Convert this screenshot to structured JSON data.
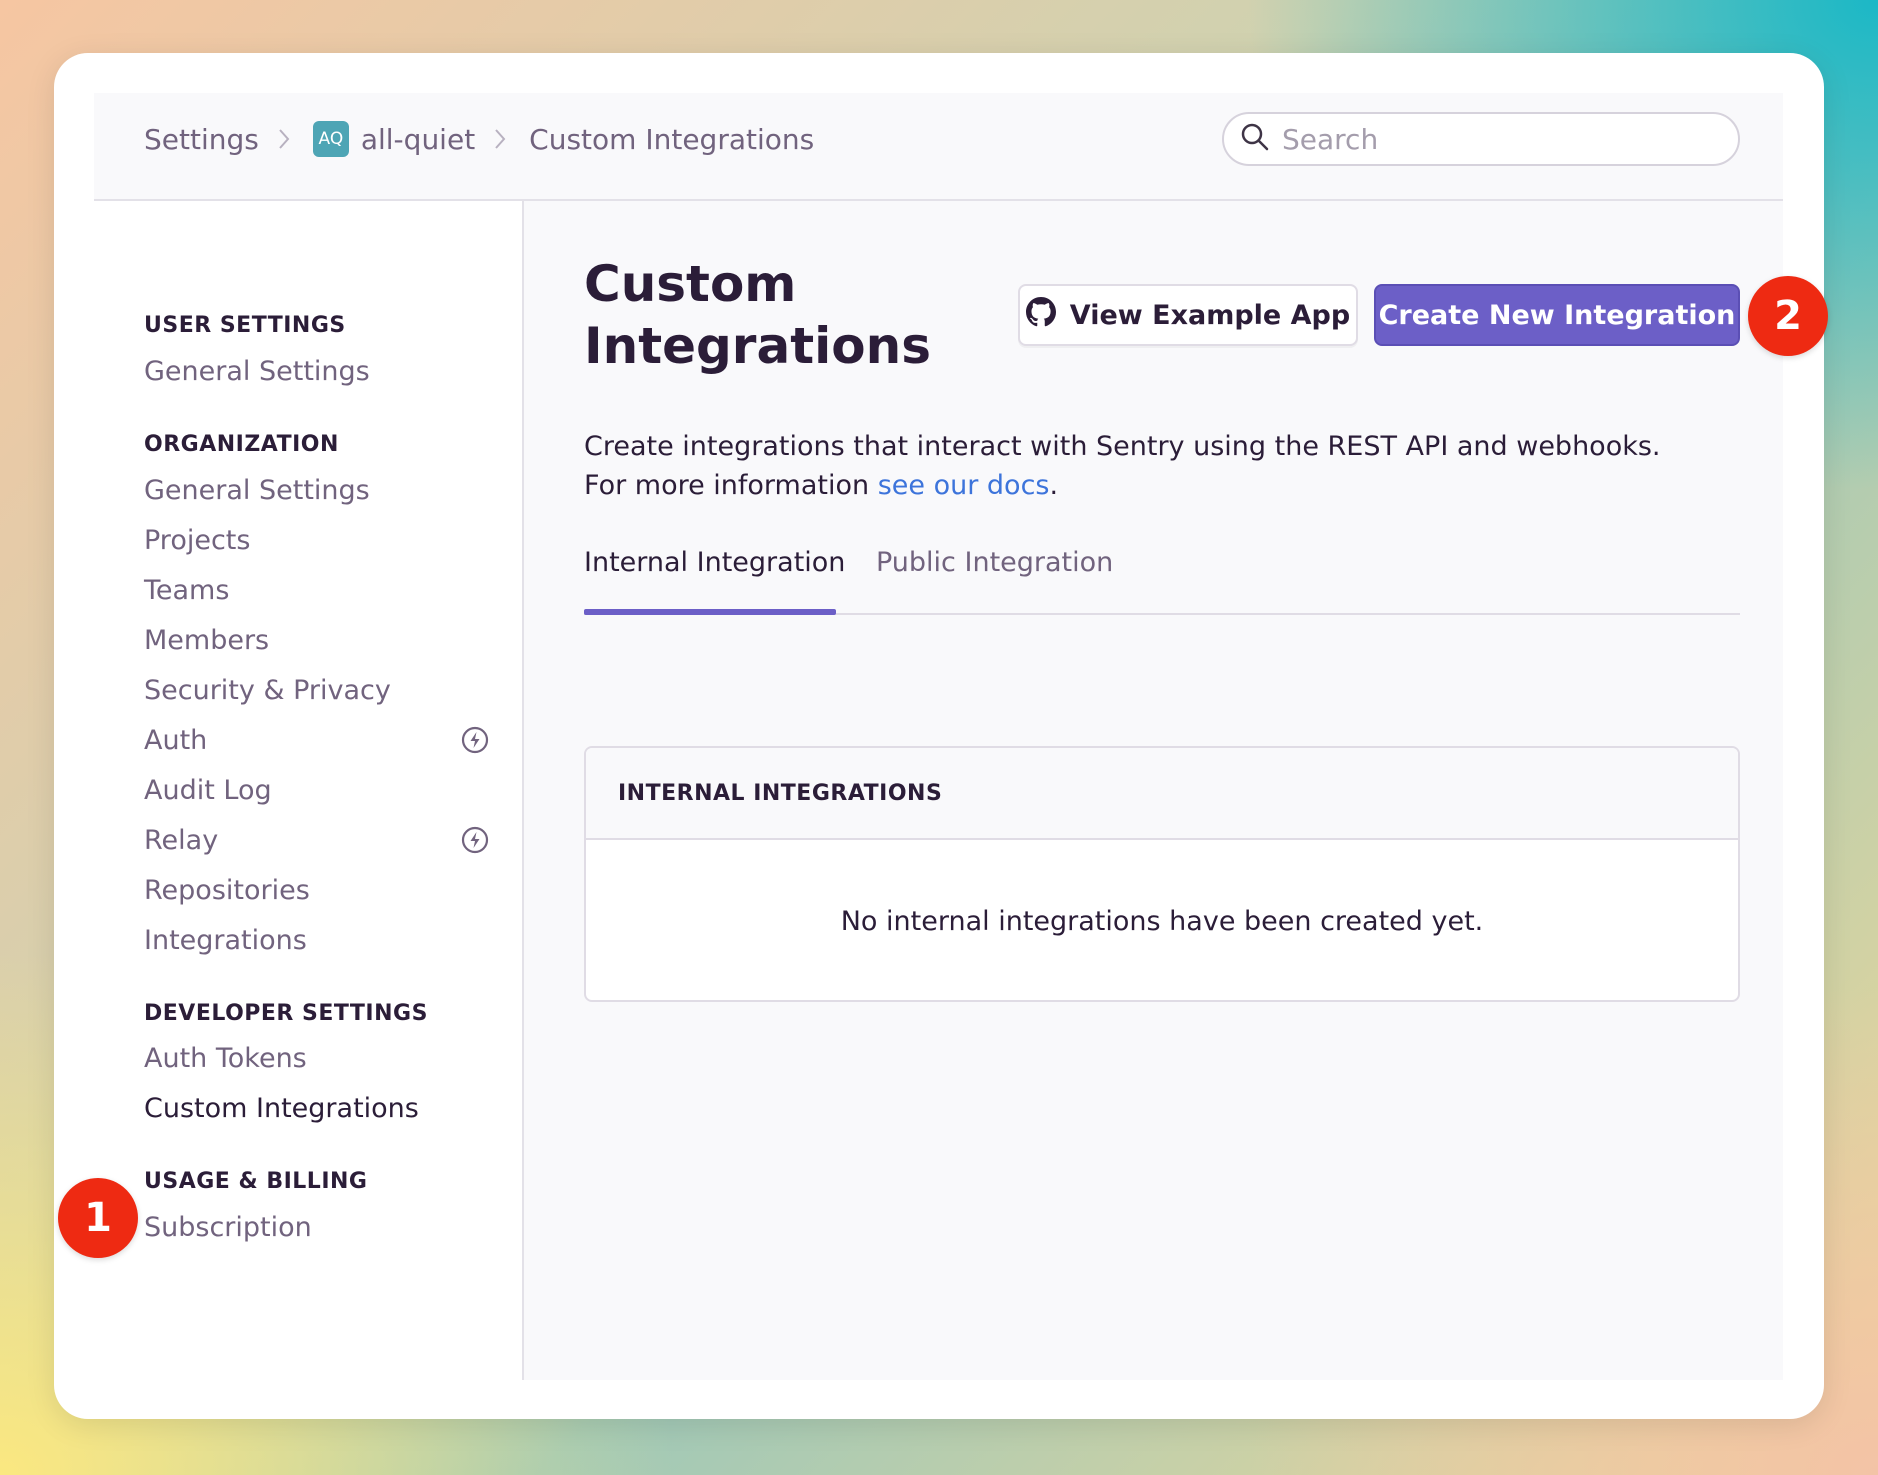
{
  "breadcrumb": {
    "settings": "Settings",
    "org_initials": "AQ",
    "org_name": "all-quiet",
    "current": "Custom Integrations"
  },
  "search": {
    "placeholder": "Search"
  },
  "sidebar": {
    "user_settings_title": "USER SETTINGS",
    "user_settings_items": [
      "General Settings"
    ],
    "organization_title": "ORGANIZATION",
    "organization_items": [
      "General Settings",
      "Projects",
      "Teams",
      "Members",
      "Security & Privacy",
      "Auth",
      "Audit Log",
      "Relay",
      "Repositories",
      "Integrations"
    ],
    "developer_title": "DEVELOPER SETTINGS",
    "developer_items": [
      "Auth Tokens",
      "Custom Integrations"
    ],
    "billing_title": "USAGE & BILLING",
    "billing_items": [
      "Subscription"
    ]
  },
  "main": {
    "title_line1": "Custom",
    "title_line2": "Integrations",
    "view_example_label": "View Example App",
    "create_label": "Create New Integration",
    "desc_line1": "Create integrations that interact with Sentry using the REST API and webhooks.",
    "desc_line2_prefix": "For more information ",
    "desc_link": "see our docs",
    "desc_line2_suffix": ".",
    "tabs": [
      "Internal Integration",
      "Public Integration"
    ],
    "panel_title": "INTERNAL INTEGRATIONS",
    "panel_empty": "No internal integrations have been created yet."
  },
  "steps": {
    "one": "1",
    "two": "2"
  },
  "colors": {
    "accent": "#6c5fc7",
    "step_badge": "#ee2a12",
    "link": "#3d74db"
  },
  "icons": {
    "search": "search-icon",
    "github": "github-icon",
    "bolt": "lightning-icon",
    "chevron": "chevron-right-icon"
  }
}
